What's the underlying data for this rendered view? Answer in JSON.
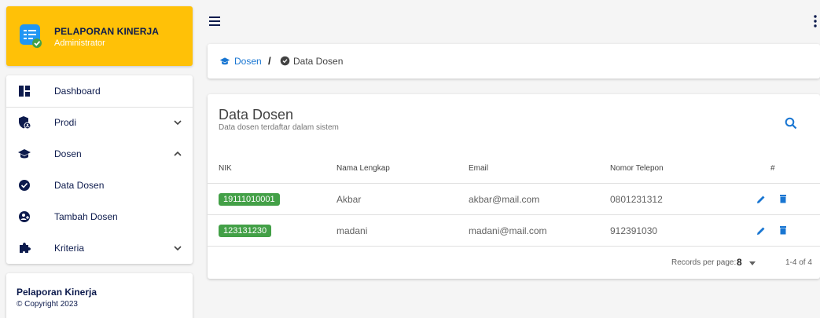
{
  "brand": {
    "title": "PELAPORAN KINERJA",
    "subtitle": "Administrator",
    "logo_icon": "report-check-icon"
  },
  "menu": {
    "items": [
      {
        "label": "Dashboard",
        "icon": "dashboard-icon",
        "expanded": null
      },
      {
        "label": "Prodi",
        "icon": "shield-user-icon",
        "expanded": false
      },
      {
        "label": "Dosen",
        "icon": "school-icon",
        "expanded": true
      },
      {
        "label": "Data Dosen",
        "icon": "badge-check-icon",
        "expanded": null
      },
      {
        "label": "Tambah Dosen",
        "icon": "account-plus-icon",
        "expanded": null
      },
      {
        "label": "Kriteria",
        "icon": "puzzle-icon",
        "expanded": false
      }
    ]
  },
  "footer": {
    "title": "Pelaporan Kinerja",
    "copyright": "© Copyright 2023"
  },
  "breadcrumb": {
    "parent": "Dosen",
    "separator": "/",
    "current": "Data Dosen"
  },
  "card": {
    "title": "Data Dosen",
    "subtitle": "Data dosen terdaftar dalam sistem"
  },
  "table": {
    "headers": [
      "NIK",
      "Nama Lengkap",
      "Email",
      "Nomor Telepon",
      "#"
    ],
    "rows": [
      {
        "nik": "19111010001",
        "nama": "Akbar",
        "email": "akbar@mail.com",
        "telepon": "0801231312"
      },
      {
        "nik": "123131230",
        "nama": "madani",
        "email": "madani@mail.com",
        "telepon": "912391030"
      }
    ]
  },
  "pagination": {
    "label": "Records per page:",
    "per_page": "8",
    "range": "1-4 of 4"
  },
  "colors": {
    "brand": "#ffc107",
    "accent": "#1976d2",
    "nik_chip": "#43a047",
    "nav_text": "#0d1b4d"
  }
}
